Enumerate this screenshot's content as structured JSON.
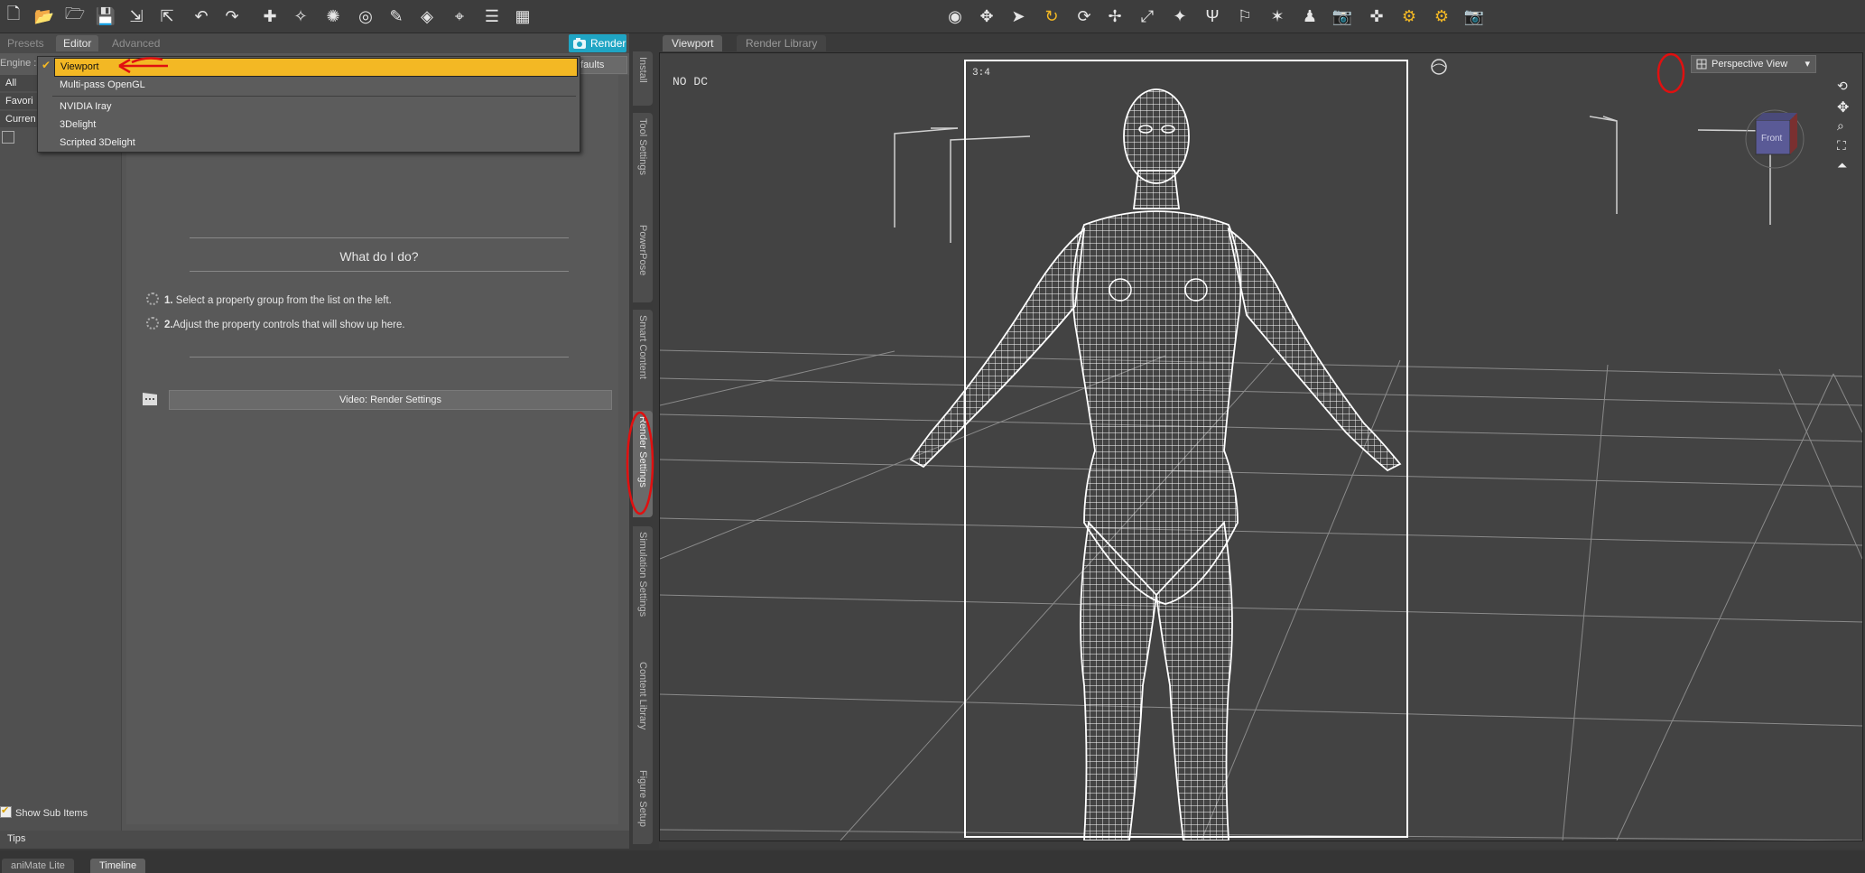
{
  "toolbar": {
    "icons": [
      "new-file-icon",
      "open-file-icon",
      "open-folder-icon",
      "save-icon",
      "import-icon",
      "export-icon",
      "undo-icon",
      "redo-icon",
      "scene-tool-icon",
      "joint-editor-icon",
      "node-weight-icon",
      "surface-selection-icon",
      "geometry-editor-icon",
      "spot-render-icon",
      "node-select-icon",
      "align-icon",
      "grid-icon"
    ],
    "right_icons": [
      "view-camera-icon",
      "universal-tool-icon",
      "pointer-icon",
      "rotate-icon",
      "twist-icon",
      "translate-icon",
      "scale-icon",
      "transform-icon",
      "surface-tool-icon",
      "joint-tool-icon",
      "weight-map-icon",
      "figure-icon",
      "camera-icon",
      "render-settings-icon",
      "active-pose-icon",
      "gear-icon",
      "render-icon"
    ]
  },
  "left_pane": {
    "tabs": [
      "Presets",
      "Editor",
      "Advanced"
    ],
    "active_tab": "Editor",
    "render_button": "Render",
    "engine_label": "Engine :",
    "defaults_button": "efaults",
    "sidelist": [
      "All",
      "Favori",
      "Curren"
    ],
    "heading": "What do I do?",
    "steps": [
      {
        "num": "1.",
        "text": "Select a property group from the list on the left."
      },
      {
        "num": "2.",
        "text": "Adjust the property controls that will show up here."
      }
    ],
    "video_button": "Video: Render Settings",
    "show_sub_items": "Show Sub Items",
    "tips": "Tips"
  },
  "dropdown": {
    "selected": "Viewport",
    "items": [
      "Viewport",
      "Multi-pass OpenGL",
      "NVIDIA Iray",
      "3Delight",
      "Scripted 3Delight"
    ]
  },
  "vertical_tabs": [
    "Install",
    "Tool Settings",
    "PowerPose",
    "Smart Content",
    "Render Settings",
    "Simulation Settings",
    "Content Library",
    "Figure Setup"
  ],
  "active_vertical_tab": "Render Settings",
  "viewport": {
    "tabs": [
      "Viewport",
      "Render Library"
    ],
    "active_tab": "Viewport",
    "aspect_label": "3:4",
    "hud_text": "NO DC",
    "view_dropdown": "Perspective View",
    "cube_face": "Front"
  },
  "bottom_tabs": [
    "aniMate Lite",
    "Timeline"
  ],
  "active_bottom_tab": "Timeline",
  "colors": {
    "accent": "#f3b824",
    "render_blue": "#1fa5c4",
    "annotation": "#e01010"
  }
}
